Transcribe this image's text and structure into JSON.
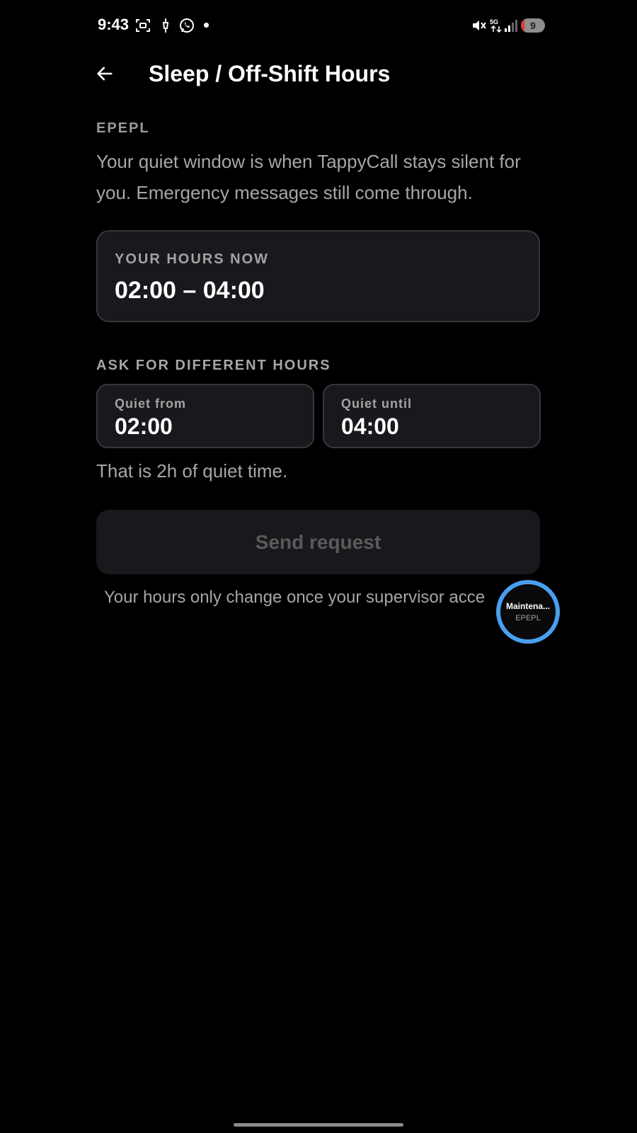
{
  "status_bar": {
    "time": "9:43",
    "battery_level": "9",
    "battery_fraction": 0.09,
    "network_label": "5G"
  },
  "header": {
    "title": "Sleep / Off-Shift Hours"
  },
  "org_label": "EPEPL",
  "description": "Your quiet window is when TappyCall stays silent for you. Emergency messages still come through.",
  "current_hours": {
    "label": "YOUR HOURS NOW",
    "value": "02:00 – 04:00"
  },
  "request": {
    "section_label": "ASK FOR DIFFERENT HOURS",
    "from_label": "Quiet from",
    "from_value": "02:00",
    "until_label": "Quiet until",
    "until_value": "04:00",
    "duration_note": "That is 2h of quiet time.",
    "send_label": "Send request",
    "footnote": "Your hours only change once your supervisor acce"
  },
  "bubble": {
    "title": "Maintena...",
    "subtitle": "EPEPL"
  },
  "colors": {
    "accent_ring": "#4a9eee",
    "card_bg": "#18191c",
    "battery_red": "#e53935"
  }
}
